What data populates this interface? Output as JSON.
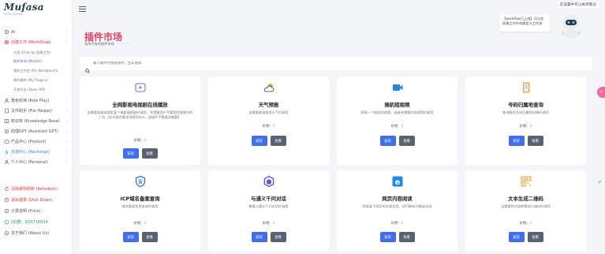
{
  "app": {
    "logo_title": "Mufasa",
    "logo_sub": "AI Pro System"
  },
  "topbar": {
    "notice": "在设置中可以关闭我😊"
  },
  "sidebar": {
    "items": [
      {
        "label": "AI"
      },
      {
        "label": "创建工作 (WorkShop)"
      },
      {
        "label": "对话 (Chat by 创建工作)"
      },
      {
        "label": "插件市场 (Market)"
      },
      {
        "label": "我的工作台 (My Workbench)"
      },
      {
        "label": "我的插件 (My Plugins)"
      },
      {
        "label": "开放平台 (Open API)"
      },
      {
        "label": "角色扮演 (Role Play)"
      },
      {
        "label": "文件助手 (File Helper)"
      },
      {
        "label": "知识库 (Knowledge Base)"
      },
      {
        "label": "助理GPT (Assistant GPT)"
      },
      {
        "label": "产品中心 (Product)"
      },
      {
        "label": "充值中心 (Recharge)"
      },
      {
        "label": "个人中心 (Personal)"
      },
      {
        "label": "清除缓存刷新 (Refurbish)"
      },
      {
        "label": "退出登录 (Shut Down)"
      },
      {
        "label": "计费说明 (Price)"
      },
      {
        "label": "QQ群：833716034"
      },
      {
        "label": "关于我们 (About Us)"
      }
    ]
  },
  "page": {
    "title": "插件市场",
    "subtitle": "无所不有的插件市场",
    "dots": "⚬⚬⚬⚬"
  },
  "assistant": {
    "bubble": "【workflow已上线】可以在 创建工作中创建定义工作流"
  },
  "search": {
    "placeholder": "输入插件名搜索插件，回车搜索"
  },
  "cards": [
    {
      "icon": "video-player-icon",
      "title": "全网影视电视剧在线播放",
      "desc": "当需要观看或搜索某个电影电视剧时调用，并提醒用户不要相信视频内的广告【仅对插件要求消耗Token，该插件不需要消耗额】",
      "price_label": "价格：",
      "price": "0",
      "install": "安装",
      "view": "查看"
    },
    {
      "icon": "weather-icon",
      "title": "天气预报",
      "desc": "当需要查询某地天气时调用",
      "price_label": "价格：",
      "price": "0",
      "install": "安装",
      "view": "查看"
    },
    {
      "icon": "video-camera-icon",
      "title": "随机短视频",
      "desc": "获取一个随机短视频，或者有需要时短视频时调用",
      "price_label": "价格：",
      "price": "0",
      "install": "安装",
      "view": "查看"
    },
    {
      "icon": "phone-book-icon",
      "title": "号码归属地查询",
      "desc": "查询电话号码归属地详情时调用",
      "price_label": "价格：",
      "price": "0",
      "install": "安装",
      "view": "查看"
    },
    {
      "icon": "shield-icon",
      "title": "ICP域名备案查询",
      "desc": "域名备案信息查询时调用",
      "price_label": "价格：",
      "price": "0",
      "install": "安装",
      "view": "查看"
    },
    {
      "icon": "ai-chat-icon",
      "title": "与通义千问对话",
      "desc": "需要与通义千问对话时调用",
      "price_label": "价格：",
      "price": "0",
      "install": "安装",
      "view": "查看"
    },
    {
      "icon": "browser-icon",
      "title": "网页内容阅读",
      "desc": "获取某个网页的文本信息，进行解析问题或总结",
      "price_label": "价格：",
      "price": "0",
      "install": "安装",
      "view": "查看"
    },
    {
      "icon": "qr-code-icon",
      "title": "文本生成二维码",
      "desc": "当需要将内容转换成二维码时调用",
      "price_label": "价格：",
      "price": "0",
      "install": "安装",
      "view": "查看"
    }
  ],
  "colors": {
    "accent": "#e8415e",
    "primary_button": "#3f6ef2",
    "secondary_button": "#5b6170",
    "price": "#f0a030"
  }
}
